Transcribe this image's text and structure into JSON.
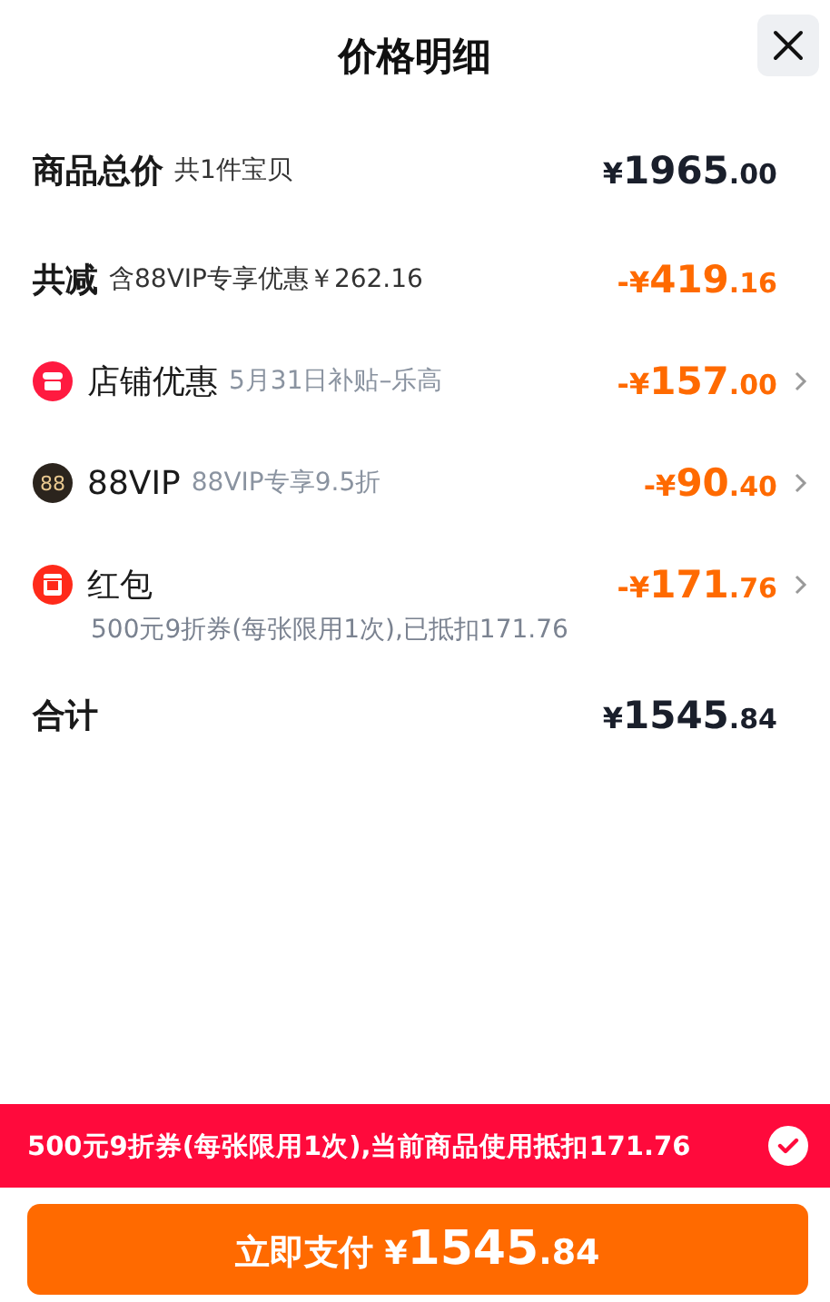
{
  "title": "价格明细",
  "rows": [
    {
      "label": "商品总价",
      "note": "共1件宝贝",
      "discount": false,
      "price": {
        "prefix": "¥",
        "int": "1965",
        "dec": ".00"
      },
      "chevron": false
    },
    {
      "label": "共减",
      "note": "含88VIP专享优惠￥262.16",
      "discount": true,
      "price": {
        "prefix": "-¥",
        "int": "419",
        "dec": ".16"
      },
      "chevron": false
    },
    {
      "kind": "shop",
      "label": "店铺优惠",
      "note": "5月31日补贴–乐高",
      "discount": true,
      "price": {
        "prefix": "-¥",
        "int": "157",
        "dec": ".00"
      },
      "chevron": true
    },
    {
      "kind": "vip",
      "badge": "88",
      "label": "88VIP",
      "note": "88VIP专享9.5折",
      "discount": true,
      "price": {
        "prefix": "-¥",
        "int": "90",
        "dec": ".40"
      },
      "chevron": true
    },
    {
      "kind": "redpacket",
      "label": "红包",
      "detail": "500元9折券(每张限用1次),已抵扣171.76",
      "discount": true,
      "price": {
        "prefix": "-¥",
        "int": "171",
        "dec": ".76"
      },
      "chevron": true
    },
    {
      "label": "合计",
      "discount": false,
      "price": {
        "prefix": "¥",
        "int": "1545",
        "dec": ".84"
      },
      "chevron": false
    }
  ],
  "banner": {
    "text": "500元9折券(每张限用1次),当前商品使用抵扣171.76",
    "checked": true
  },
  "pay_button": {
    "label": "立即支付",
    "price": {
      "prefix": "¥",
      "int": "1545",
      "dec": ".84"
    }
  }
}
